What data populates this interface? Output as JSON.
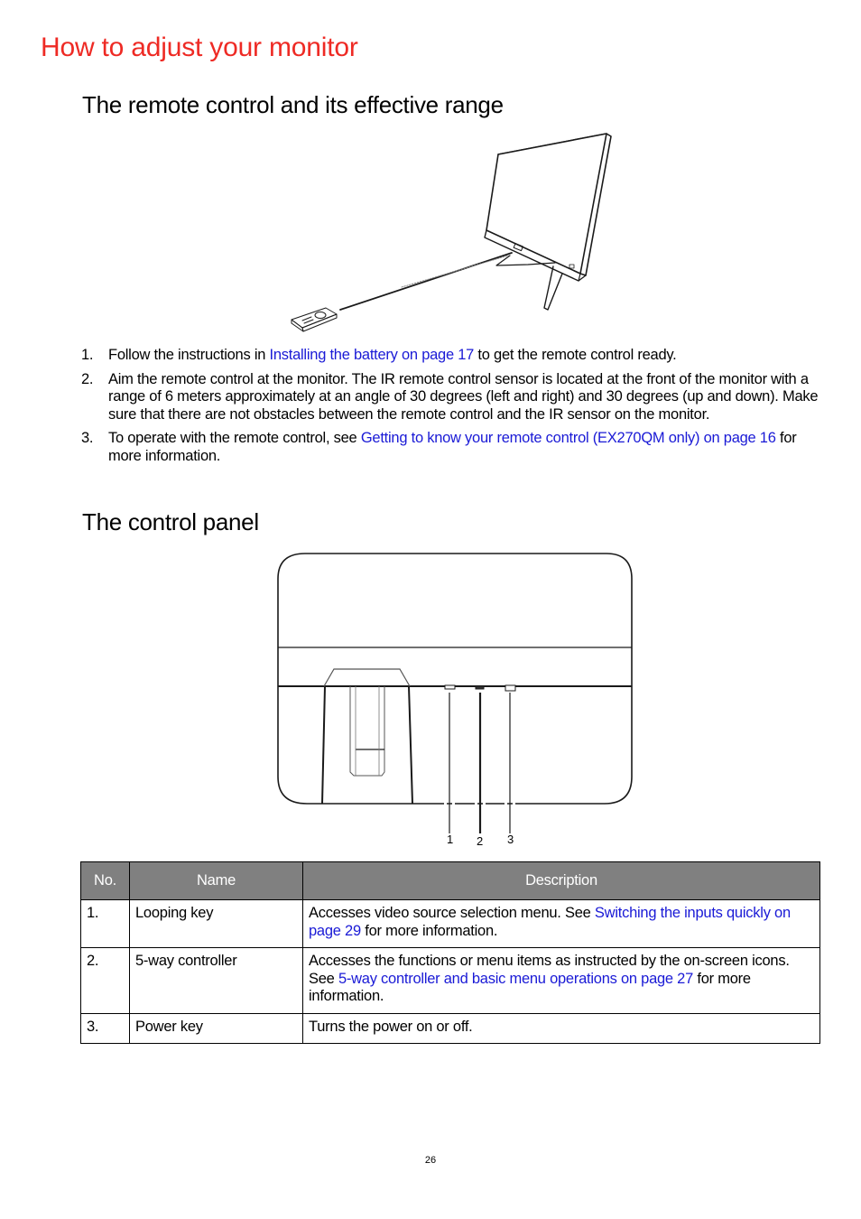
{
  "page": {
    "title": "How to adjust your monitor",
    "page_number": "26"
  },
  "remote_section": {
    "heading": "The remote control and its effective range",
    "figure": "remote-control-pointing-at-monitor-illustration",
    "steps": [
      {
        "num": "1.",
        "before": "Follow the instructions in ",
        "link": "Installing the battery on page 17",
        "after": " to get the remote control ready."
      },
      {
        "num": "2.",
        "before": "Aim the remote control at the monitor. The IR remote control sensor is located at the front of the monitor with a range of 6 meters approximately at an angle of 30 degrees (left and right) and 30 degrees (up and down). Make sure that there are not obstacles between the remote control and the IR sensor on the monitor.",
        "link": "",
        "after": ""
      },
      {
        "num": "3.",
        "before": "To operate with the remote control, see ",
        "link": "Getting to know your remote control (EX270QM only) on page 16",
        "after": " for more information."
      }
    ]
  },
  "panel_section": {
    "heading": "The control panel",
    "figure": "monitor-bottom-control-panel-illustration",
    "callouts": [
      "1",
      "2",
      "3"
    ],
    "table": {
      "headers": [
        "No.",
        "Name",
        "Description"
      ],
      "rows": [
        {
          "no": "1.",
          "name": "Looping key",
          "desc_before": "Accesses video source selection menu. See ",
          "desc_link": "Switching the inputs quickly on page 29",
          "desc_after": " for more information."
        },
        {
          "no": "2.",
          "name": "5-way controller",
          "desc_before": "Accesses the functions or menu items as instructed by the on-screen icons. See ",
          "desc_link": "5-way controller and basic menu operations on page 27",
          "desc_after": " for more information."
        },
        {
          "no": "3.",
          "name": "Power key",
          "desc_before": "Turns the power on or off.",
          "desc_link": "",
          "desc_after": ""
        }
      ]
    }
  },
  "colors": {
    "title_red": "#ee2a24",
    "link_blue": "#1a1ad6",
    "table_header_gray": "#808080"
  }
}
